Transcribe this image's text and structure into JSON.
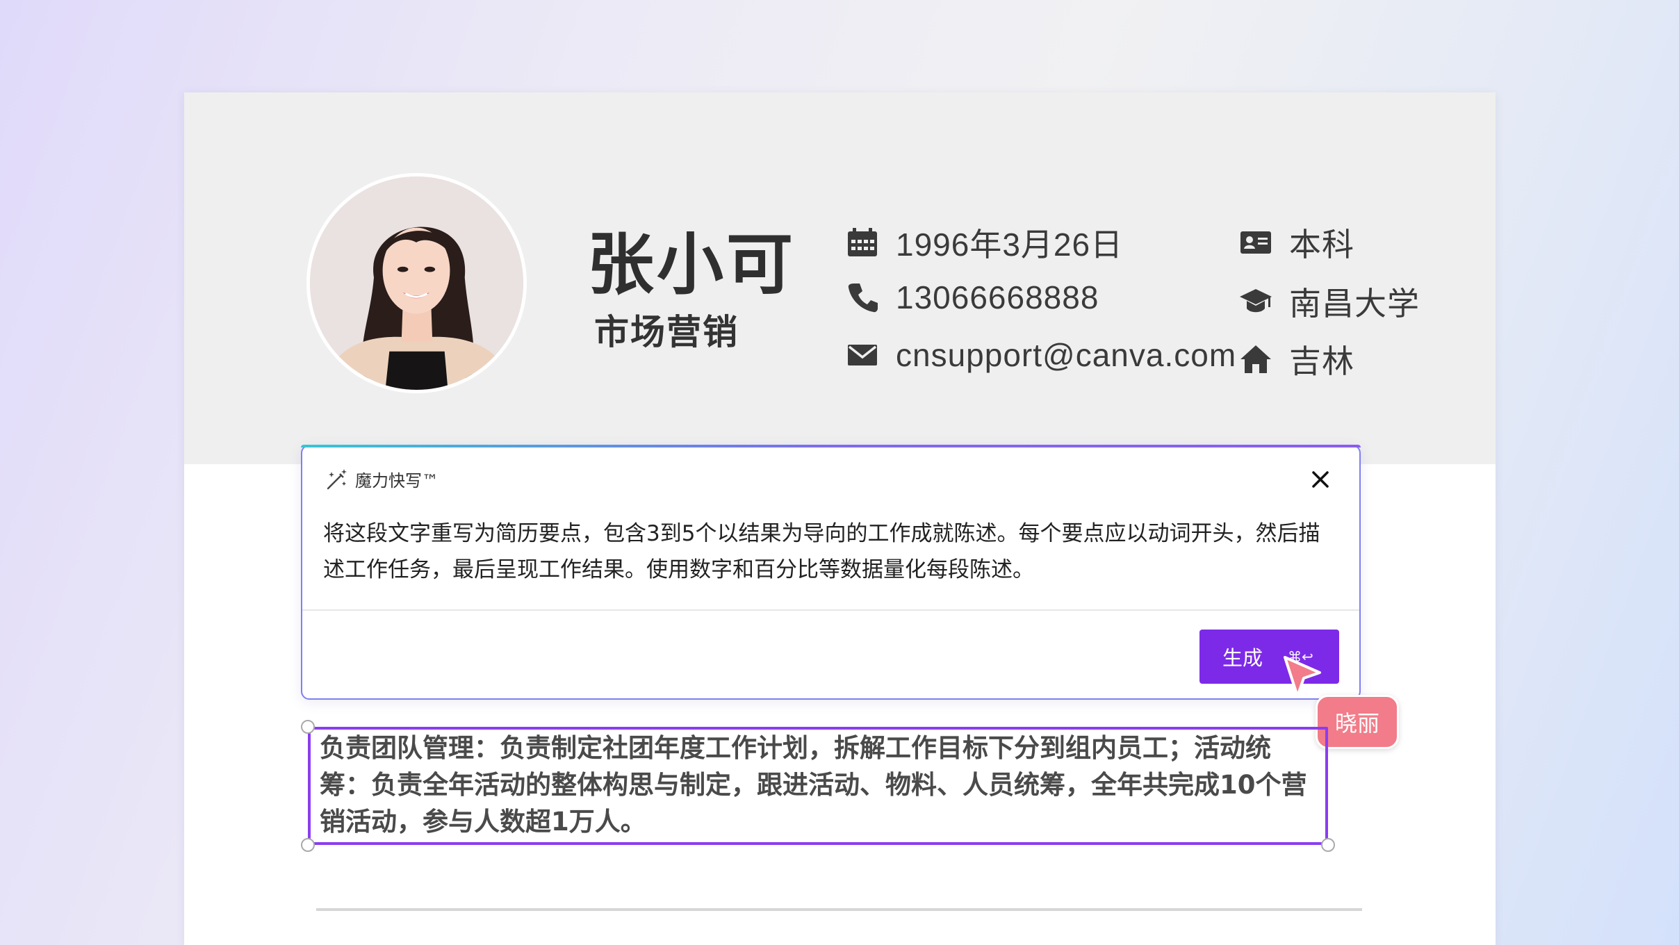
{
  "profile": {
    "name": "张小可",
    "role": "市场营销",
    "birthday": "1996年3月26日",
    "phone": "13066668888",
    "email": "cnsupport@canva.com",
    "degree": "本科",
    "university": "南昌大学",
    "hometown": "吉林"
  },
  "icons": {
    "birthday": "calendar-icon",
    "phone": "phone-icon",
    "email": "mail-icon",
    "degree": "id-card-icon",
    "university": "graduation-cap-icon",
    "hometown": "home-icon"
  },
  "magic_write": {
    "title": "魔力快写™",
    "prompt": "将这段文字重写为简历要点，包含3到5个以结果为导向的工作成就陈述。每个要点应以动词开头，然后描述工作任务，最后呈现工作结果。使用数字和百分比等数据量化每段陈述。",
    "generate_label": "生成",
    "shortcut": "⌘↩"
  },
  "collaborator": {
    "name": "晓丽",
    "color": "#f27c89"
  },
  "selected_text": "负责团队管理：负责制定社团年度工作计划，拆解工作目标下分到组内员工；活动统筹：负责全年活动的整体构思与制定，跟进活动、物料、人员统筹，全年共完成10个营销活动，参与人数超1万人。",
  "colors": {
    "accent": "#7d2ae8",
    "selection": "#8b3df0",
    "header_bg": "#efefef"
  }
}
